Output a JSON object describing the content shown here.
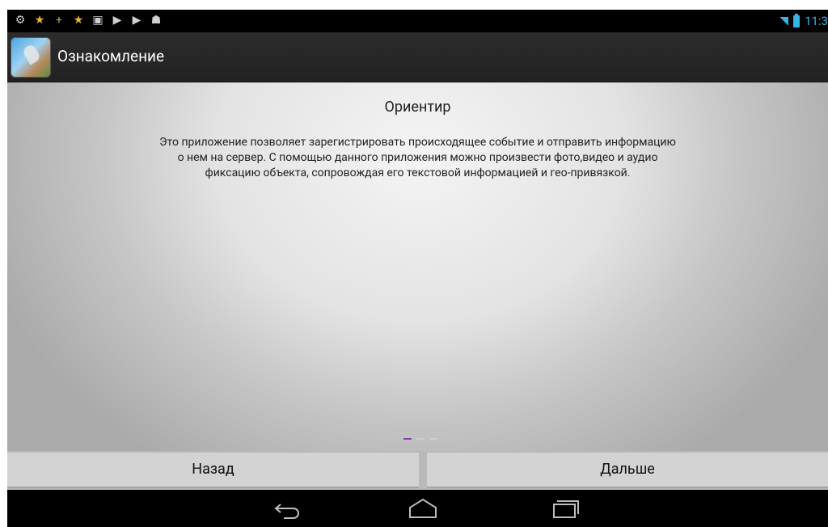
{
  "status_bar": {
    "time": "11:3",
    "notification_icons": [
      "gear-icon",
      "star-icon",
      "plus-icon",
      "star-icon",
      "image-icon",
      "bag-icon",
      "bag-icon",
      "android-icon"
    ]
  },
  "action_bar": {
    "title": "Ознакомление"
  },
  "content": {
    "title": "Ориентир",
    "description": "Это приложение позволяет зарегистрировать происходящее событие и отправить информацию о нем на сервер. С помощью данного приложения можно произвести фото,видео и аудио фиксацию объекта, сопровождая его текстовой информацией и гео-привязкой.",
    "page_indicator": {
      "current": 1,
      "total": 3
    }
  },
  "buttons": {
    "back_label": "Назад",
    "next_label": "Дальше"
  },
  "colors": {
    "accent": "#33b5e5",
    "indicator_active": "#8e3fa9"
  }
}
